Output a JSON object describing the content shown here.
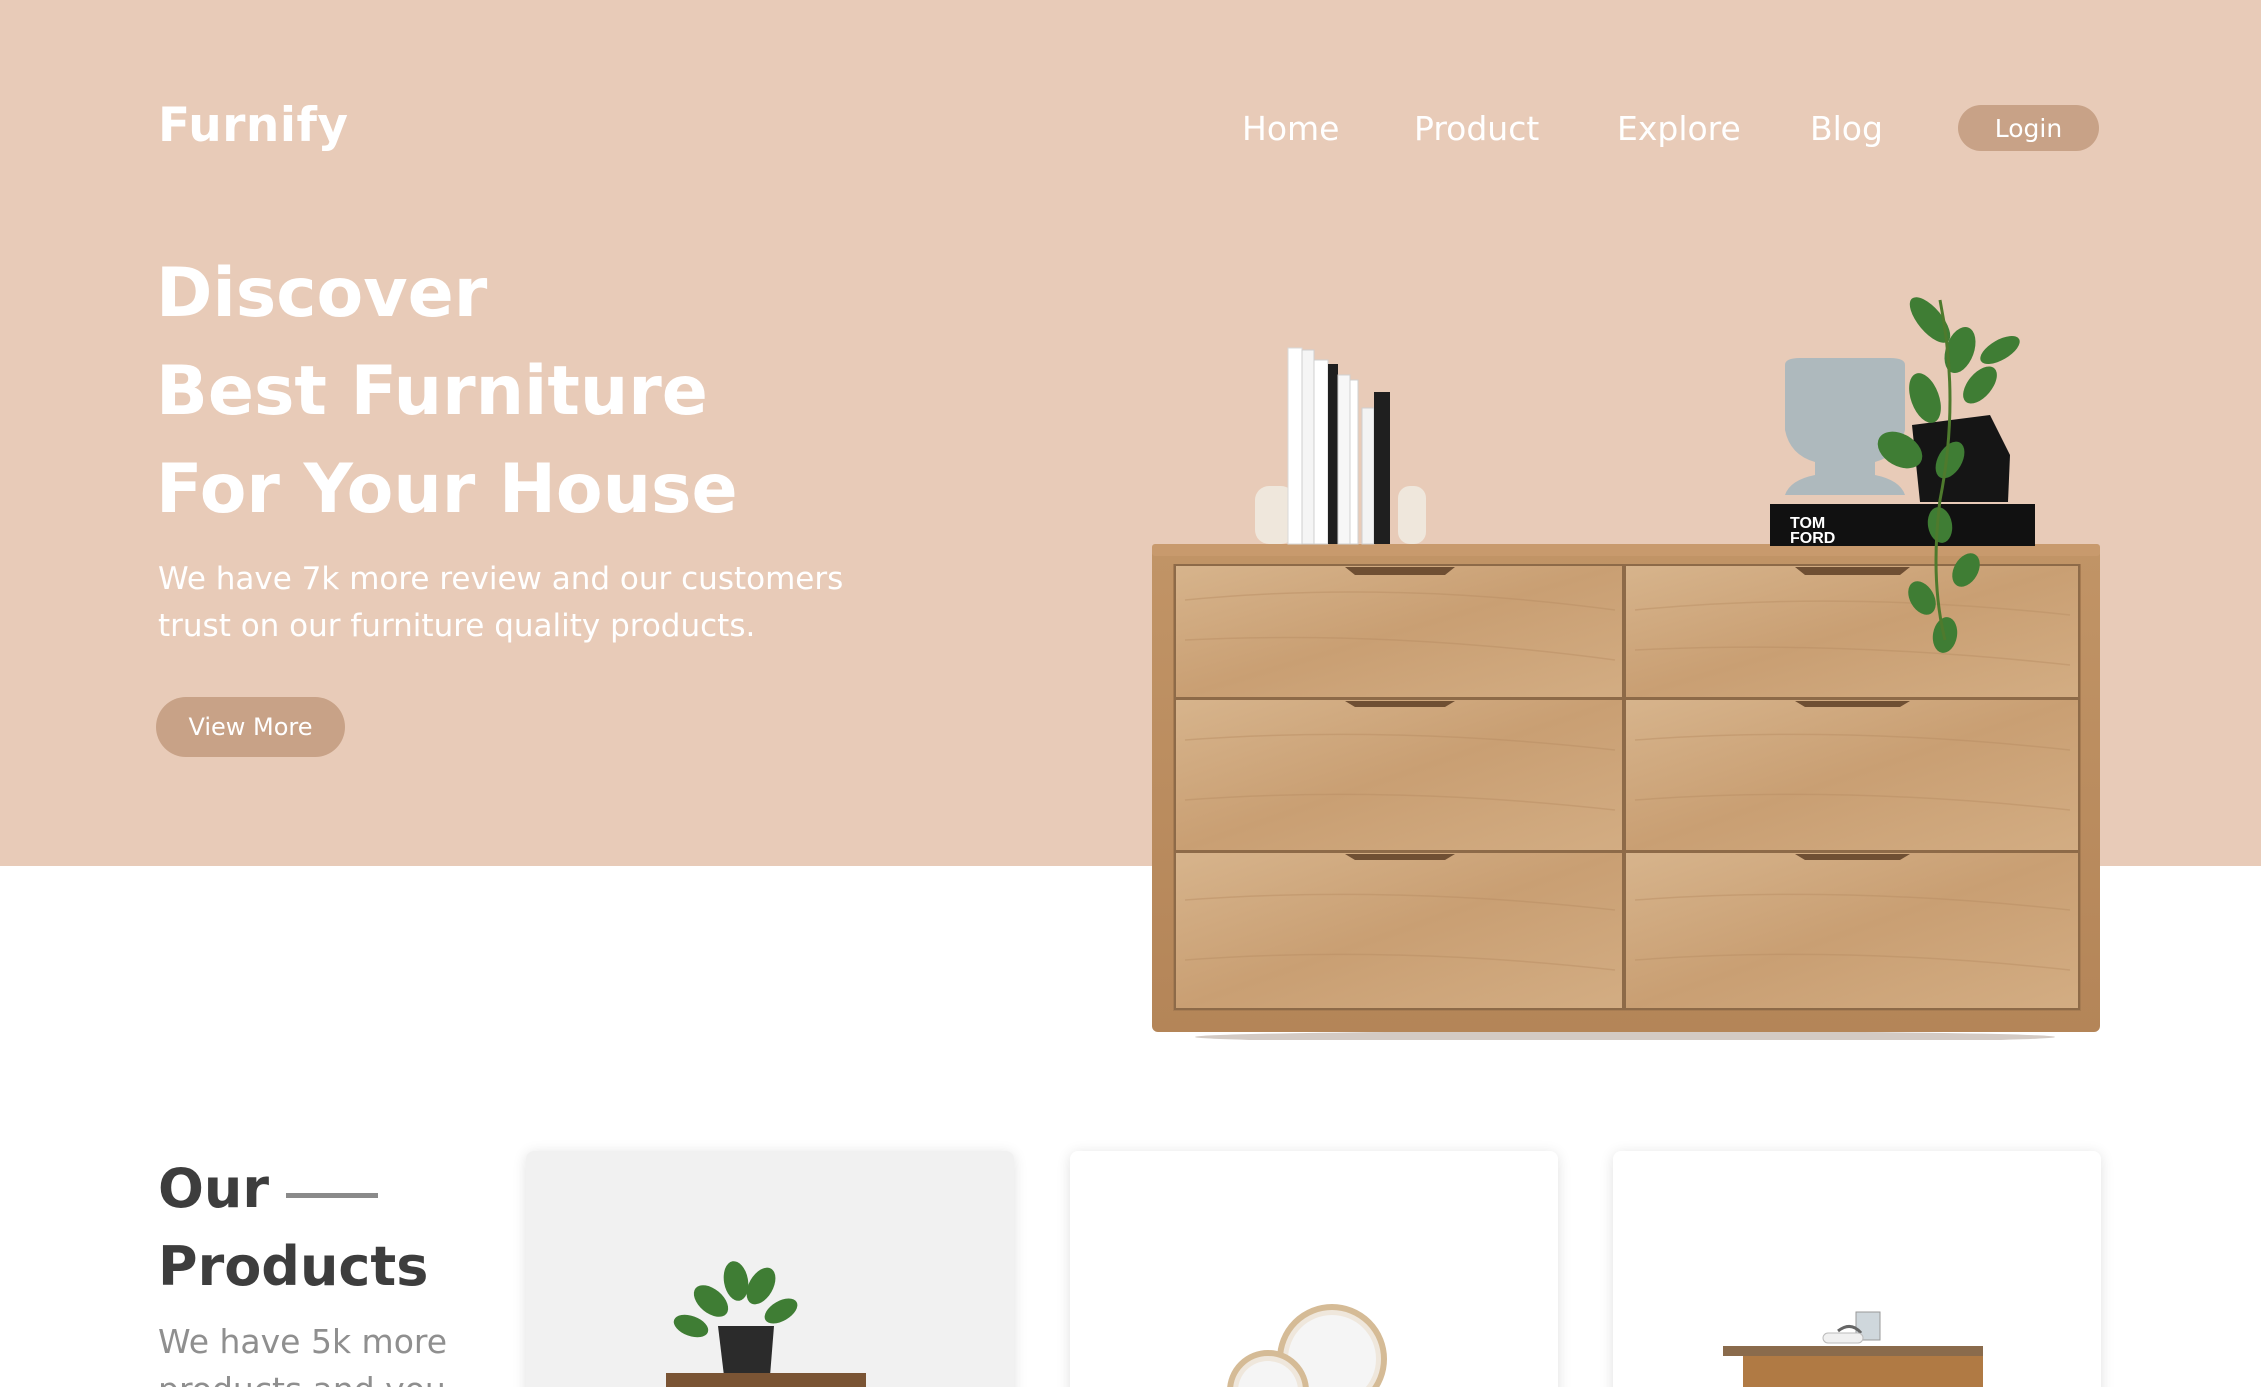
{
  "brand": {
    "name": "Furnify"
  },
  "nav": {
    "items": [
      {
        "label": "Home"
      },
      {
        "label": "Product"
      },
      {
        "label": "Explore"
      },
      {
        "label": "Blog"
      }
    ],
    "login_label": "Login"
  },
  "hero": {
    "title_lines": [
      "Discover",
      "Best Furniture",
      "For Your House"
    ],
    "description": "We have 7k more review and our customers trust on our furniture quality products.",
    "cta_label": "View More",
    "book_label": "TOM FORD"
  },
  "products": {
    "title_line1": "Our",
    "title_line2": "Products",
    "description": "We have 5k more products and you"
  },
  "colors": {
    "hero_background": "#e8cbb8",
    "accent": "#c8a287",
    "heading_dark": "#3d3d3d",
    "muted_text": "#8f8f8f"
  },
  "icons": {
    "hero_image": "wooden-dresser-image",
    "product_1": "plant-side-table-image",
    "product_2": "round-mirror-image",
    "product_3": "coffee-table-image"
  }
}
